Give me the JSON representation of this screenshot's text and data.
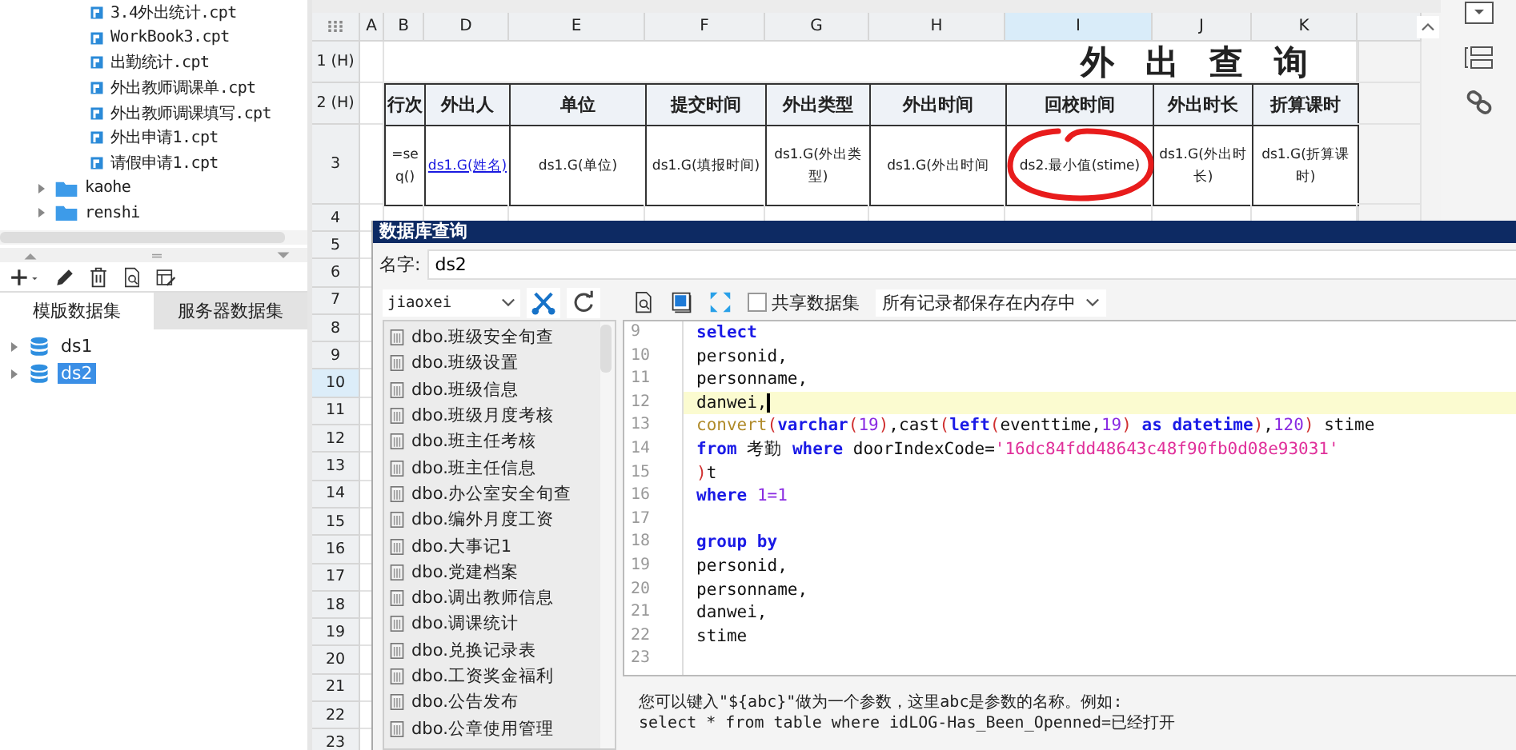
{
  "file_tree": {
    "items": [
      {
        "kind": "file",
        "label": "3.4外出统计.cpt"
      },
      {
        "kind": "file",
        "label": "WorkBook3.cpt"
      },
      {
        "kind": "file",
        "label": "出勤统计.cpt"
      },
      {
        "kind": "file",
        "label": "外出教师调课单.cpt"
      },
      {
        "kind": "file",
        "label": "外出教师调课填写.cpt"
      },
      {
        "kind": "file",
        "label": "外出申请1.cpt"
      },
      {
        "kind": "file",
        "label": "请假申请1.cpt"
      },
      {
        "kind": "folder",
        "label": "kaohe",
        "expanded": false
      },
      {
        "kind": "folder",
        "label": "renshi",
        "expanded": false
      }
    ]
  },
  "dataset_panel": {
    "tabs": [
      {
        "label": "模版数据集",
        "selected": true
      },
      {
        "label": "服务器数据集",
        "selected": false
      }
    ],
    "datasets": [
      {
        "label": "ds1",
        "selected": false
      },
      {
        "label": "ds2",
        "selected": true
      }
    ]
  },
  "sheet": {
    "columns": [
      {
        "label": "A",
        "selected": false
      },
      {
        "label": "B",
        "selected": false
      },
      {
        "label": "D",
        "selected": false
      },
      {
        "label": "E",
        "selected": false
      },
      {
        "label": "F",
        "selected": false
      },
      {
        "label": "G",
        "selected": false
      },
      {
        "label": "H",
        "selected": false
      },
      {
        "label": "I",
        "selected": true
      },
      {
        "label": "J",
        "selected": false
      },
      {
        "label": "K",
        "selected": false
      }
    ],
    "rows": [
      {
        "label": "1 (H)",
        "selected": false
      },
      {
        "label": "2 (H)",
        "selected": false
      },
      {
        "label": "3",
        "selected": false
      },
      {
        "label": "4",
        "selected": false
      },
      {
        "label": "5",
        "selected": false
      },
      {
        "label": "6",
        "selected": false
      },
      {
        "label": "7",
        "selected": false
      },
      {
        "label": "8",
        "selected": false
      },
      {
        "label": "9",
        "selected": false
      },
      {
        "label": "10",
        "selected": true
      },
      {
        "label": "11",
        "selected": false
      },
      {
        "label": "12",
        "selected": false
      },
      {
        "label": "13",
        "selected": false
      },
      {
        "label": "14",
        "selected": false
      },
      {
        "label": "15",
        "selected": false
      },
      {
        "label": "16",
        "selected": false
      },
      {
        "label": "17",
        "selected": false
      },
      {
        "label": "18",
        "selected": false
      },
      {
        "label": "19",
        "selected": false
      },
      {
        "label": "20",
        "selected": false
      },
      {
        "label": "21",
        "selected": false
      },
      {
        "label": "22",
        "selected": false
      },
      {
        "label": "23",
        "selected": false
      }
    ],
    "title": "外 出 查 询",
    "header_cells": [
      "行次",
      "外出人",
      "单位",
      "提交时间",
      "外出类型",
      "外出时间",
      "回校时间",
      "外出时长",
      "折算课时"
    ],
    "data_cells": [
      {
        "kind": "formula",
        "text": "=seq()"
      },
      {
        "kind": "link",
        "text": "ds1.G(姓名)"
      },
      {
        "kind": "plain",
        "text": "ds1.G(单位)"
      },
      {
        "kind": "plain",
        "text": "ds1.G(填报时间)"
      },
      {
        "kind": "plain",
        "text": "ds1.G(外出类型)"
      },
      {
        "kind": "plain",
        "text": "ds1.G(外出时间"
      },
      {
        "kind": "plain",
        "text": "ds2.最小值(stime)"
      },
      {
        "kind": "plain",
        "text": "ds1.G(外出时长)"
      },
      {
        "kind": "plain",
        "text": "ds1.G(折算课时)"
      }
    ]
  },
  "dialog": {
    "title": "数据库查询",
    "name_label": "名字:",
    "name_value": "ds2",
    "connection": "jiaoxei",
    "share_checkbox": {
      "label": "共享数据集",
      "checked": false
    },
    "storage_option": "所有记录都保存在内存中",
    "tables": [
      "dbo.班级安全旬查",
      "dbo.班级设置",
      "dbo.班级信息",
      "dbo.班级月度考核",
      "dbo.班主任考核",
      "dbo.班主任信息",
      "dbo.办公室安全旬查",
      "dbo.编外月度工资",
      "dbo.大事记1",
      "dbo.党建档案",
      "dbo.调出教师信息",
      "dbo.调课统计",
      "dbo.兑换记录表",
      "dbo.工资奖金福利",
      "dbo.公告发布",
      "dbo.公章使用管理"
    ],
    "code_lines": [
      {
        "number": "9",
        "highlighted": false,
        "tokens": [
          {
            "kind": "keyword",
            "text": "select"
          }
        ]
      },
      {
        "number": "10",
        "highlighted": false,
        "tokens": [
          {
            "kind": "plain",
            "text": "personid,"
          }
        ]
      },
      {
        "number": "11",
        "highlighted": false,
        "tokens": [
          {
            "kind": "plain",
            "text": "personname,"
          }
        ]
      },
      {
        "number": "12",
        "highlighted": true,
        "tokens": [
          {
            "kind": "plain",
            "text": "danwei,"
          }
        ]
      },
      {
        "number": "13",
        "highlighted": false,
        "tokens": [
          {
            "kind": "function",
            "text": "convert"
          },
          {
            "kind": "paren",
            "text": "("
          },
          {
            "kind": "keyword",
            "text": "varchar"
          },
          {
            "kind": "paren",
            "text": "("
          },
          {
            "kind": "number",
            "text": "19"
          },
          {
            "kind": "paren",
            "text": ")"
          },
          {
            "kind": "plain",
            "text": ",cast"
          },
          {
            "kind": "paren",
            "text": "("
          },
          {
            "kind": "keyword",
            "text": "left"
          },
          {
            "kind": "paren",
            "text": "("
          },
          {
            "kind": "plain",
            "text": "eventtime,"
          },
          {
            "kind": "number",
            "text": "19"
          },
          {
            "kind": "paren",
            "text": ") "
          },
          {
            "kind": "keyword",
            "text": "as datetime"
          },
          {
            "kind": "paren",
            "text": ")"
          },
          {
            "kind": "plain",
            "text": ","
          },
          {
            "kind": "number",
            "text": "120"
          },
          {
            "kind": "paren",
            "text": ")"
          },
          {
            "kind": "plain",
            "text": " stime"
          }
        ]
      },
      {
        "number": "14",
        "highlighted": false,
        "tokens": [
          {
            "kind": "keyword",
            "text": "from"
          },
          {
            "kind": "plain",
            "text": " 考勤 "
          },
          {
            "kind": "keyword",
            "text": "where"
          },
          {
            "kind": "plain",
            "text": " doorIndexCode="
          },
          {
            "kind": "string",
            "text": "'16dc84fdd48643c48f90fb0d08e93031'"
          }
        ]
      },
      {
        "number": "15",
        "highlighted": false,
        "tokens": [
          {
            "kind": "paren",
            "text": ")"
          },
          {
            "kind": "plain",
            "text": "t"
          }
        ]
      },
      {
        "number": "16",
        "highlighted": false,
        "tokens": [
          {
            "kind": "keyword",
            "text": "where "
          },
          {
            "kind": "number",
            "text": "1=1"
          }
        ]
      },
      {
        "number": "17",
        "highlighted": false
      },
      {
        "number": "18",
        "highlighted": false,
        "tokens": [
          {
            "kind": "keyword",
            "text": "group by"
          }
        ]
      },
      {
        "number": "19",
        "highlighted": false,
        "tokens": [
          {
            "kind": "plain",
            "text": "personid,"
          }
        ]
      },
      {
        "number": "20",
        "highlighted": false,
        "tokens": [
          {
            "kind": "plain",
            "text": "personname,"
          }
        ]
      },
      {
        "number": "21",
        "highlighted": false,
        "tokens": [
          {
            "kind": "plain",
            "text": "danwei,"
          }
        ]
      },
      {
        "number": "22",
        "highlighted": false,
        "tokens": [
          {
            "kind": "plain",
            "text": "stime"
          }
        ]
      },
      {
        "number": "23",
        "highlighted": false
      }
    ],
    "help_lines": [
      "您可以键入\"${abc}\"做为一个参数，这里abc是参数的名称。例如:",
      "select * from table where idLOG-Has_Been_Openned=已经打开"
    ]
  }
}
